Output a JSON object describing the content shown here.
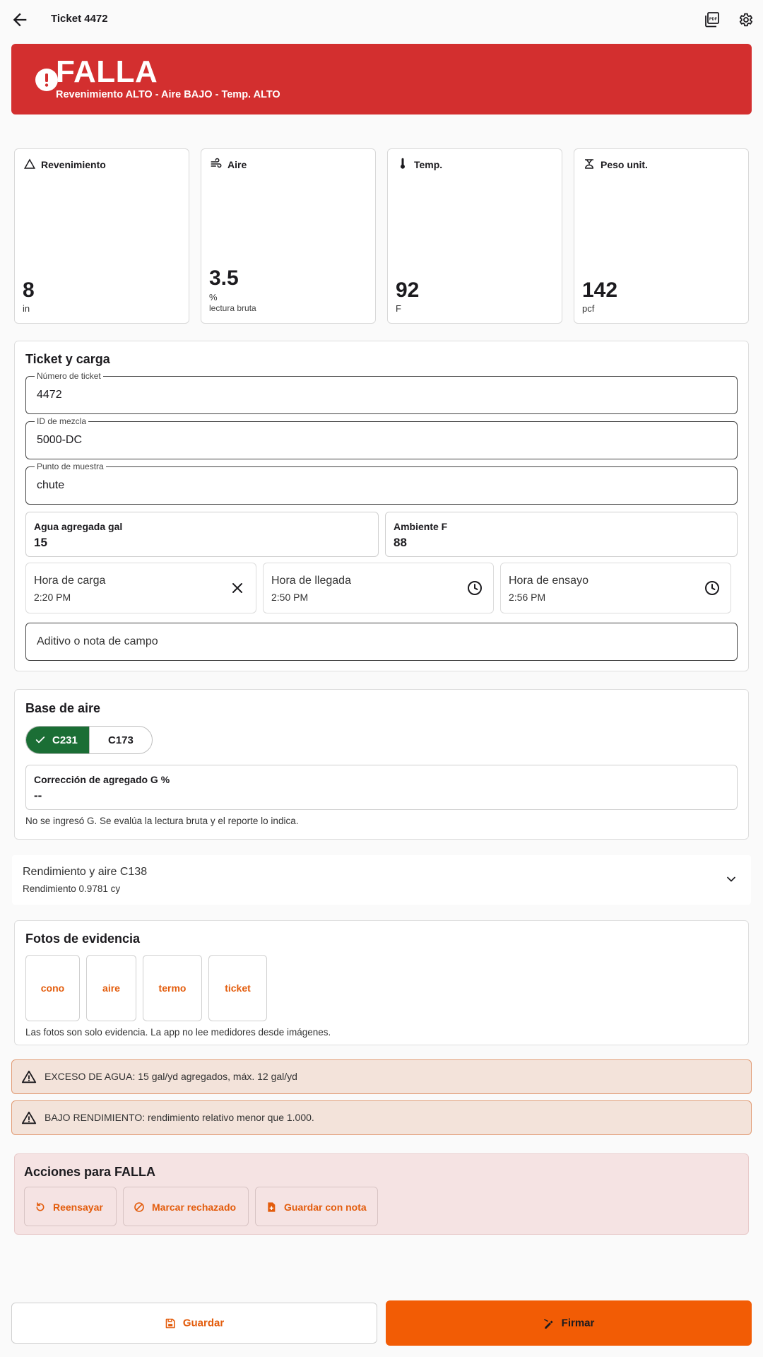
{
  "header": {
    "title": "Ticket 4472",
    "back_icon": "arrow-left-icon",
    "pdf_icon": "pdf-icon",
    "settings_icon": "gear-icon"
  },
  "status": {
    "label": "FALLA",
    "detail": "Revenimiento ALTO - Aire BAJO - Temp. ALTO",
    "color": "#d32f2f"
  },
  "metrics": [
    {
      "label": "Revenimiento",
      "icon": "triangle-icon",
      "value": "8",
      "unit": "in",
      "sub": ""
    },
    {
      "label": "Aire",
      "icon": "air-icon",
      "value": "3.5",
      "unit": "%",
      "sub": "lectura bruta"
    },
    {
      "label": "Temp.",
      "icon": "thermometer-icon",
      "value": "92",
      "unit": "F",
      "sub": ""
    },
    {
      "label": "Peso unit.",
      "icon": "scale-icon",
      "value": "142",
      "unit": "pcf",
      "sub": ""
    }
  ],
  "ticket_section": {
    "title": "Ticket y carga",
    "ticket_number": {
      "label": "Número de ticket",
      "value": "4472"
    },
    "mix_id": {
      "label": "ID de mezcla",
      "value": "5000-DC"
    },
    "sample_point": {
      "label": "Punto de muestra",
      "value": "chute"
    },
    "water_added": {
      "label": "Agua agregada gal",
      "value": "15"
    },
    "ambient": {
      "label": "Ambiente F",
      "value": "88"
    },
    "load_time": {
      "label": "Hora de carga",
      "value": "2:20 PM",
      "icon": "close-icon"
    },
    "arrival_time": {
      "label": "Hora de llegada",
      "value": "2:50 PM",
      "icon": "clock-icon"
    },
    "test_time": {
      "label": "Hora de ensayo",
      "value": "2:56 PM",
      "icon": "clock-icon"
    },
    "note": {
      "placeholder": "Aditivo o nota de campo"
    }
  },
  "air_base": {
    "title": "Base de aire",
    "options": [
      "C231",
      "C173"
    ],
    "selected": "C231",
    "correction": {
      "label": "Corrección de agregado G %",
      "value": "--"
    },
    "note": "No se ingresó G. Se evalúa la lectura bruta y el reporte lo indica."
  },
  "yield": {
    "title": "Rendimiento y aire C138",
    "subtitle": "Rendimiento 0.9781 cy"
  },
  "photos": {
    "title": "Fotos de evidencia",
    "items": [
      "cono",
      "aire",
      "termo",
      "ticket"
    ],
    "note": "Las fotos son solo evidencia. La app no lee medidores desde imágenes."
  },
  "warnings": [
    "EXCESO DE AGUA: 15 gal/yd agregados, máx. 12 gal/yd",
    "BAJO RENDIMIENTO: rendimiento relativo menor que 1.000."
  ],
  "actions": {
    "title": "Acciones para FALLA",
    "buttons": [
      "Reensayar",
      "Marcar rechazado",
      "Guardar con nota"
    ]
  },
  "footer": {
    "save": "Guardar",
    "sign": "Firmar"
  },
  "colors": {
    "accent": "#f25c05",
    "fail": "#d32f2f",
    "selected": "#1b6e35",
    "warning_bg": "#f3e3da"
  }
}
